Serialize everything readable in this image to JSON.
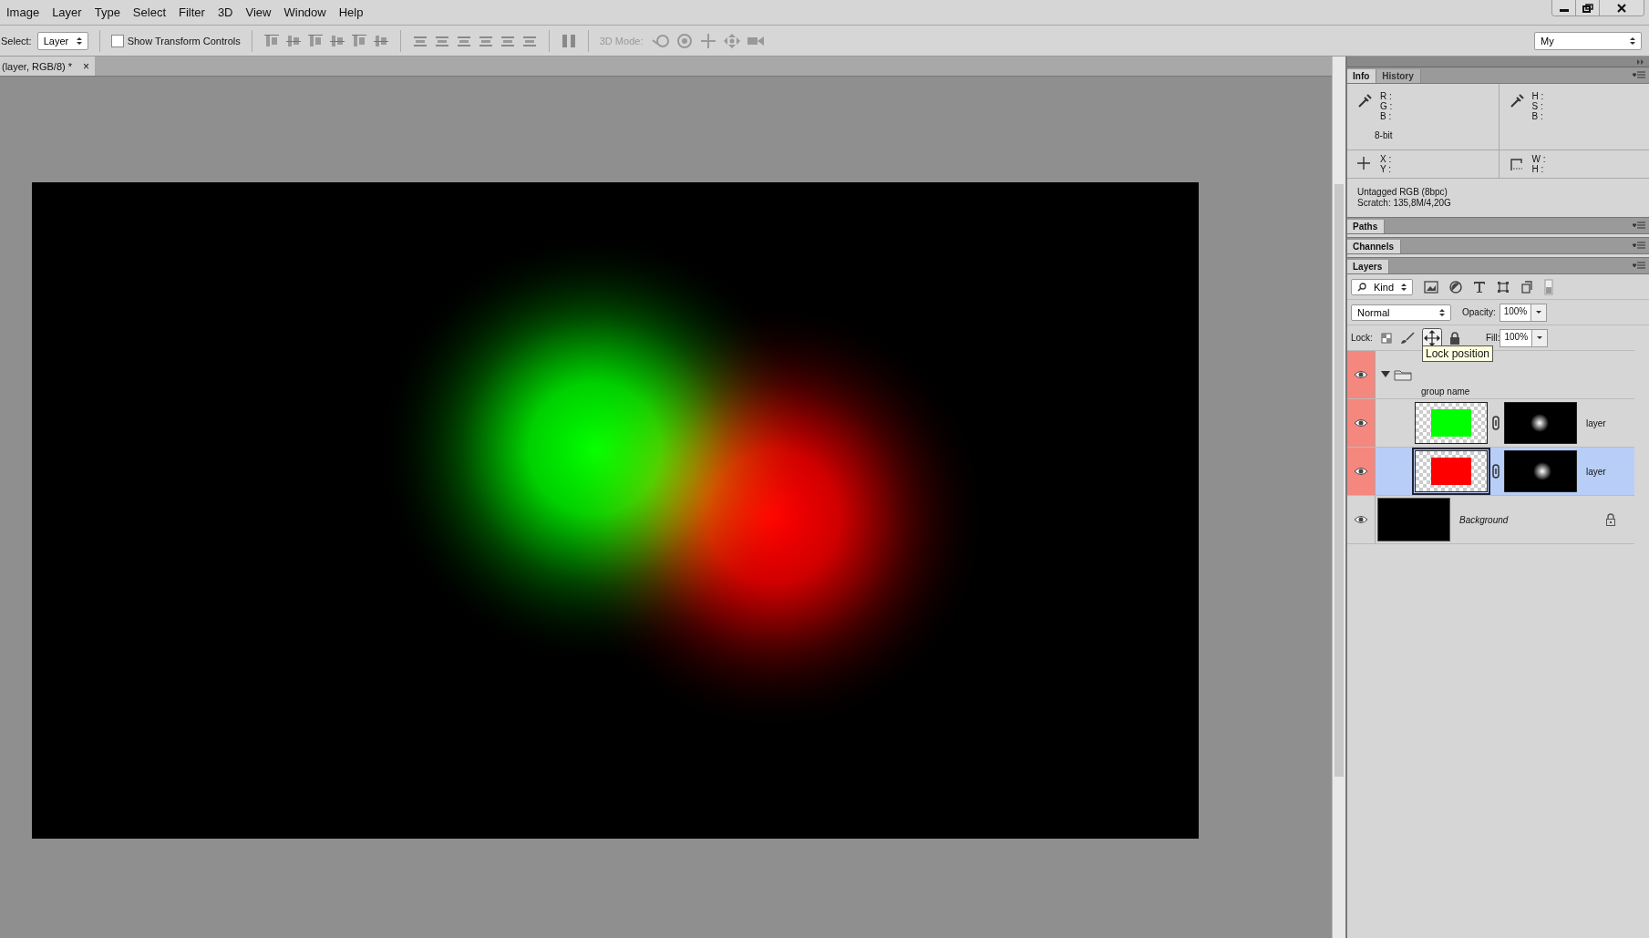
{
  "menu": [
    {
      "label": "Image"
    },
    {
      "label": "Layer"
    },
    {
      "label": "Type"
    },
    {
      "label": "Select"
    },
    {
      "label": "Filter"
    },
    {
      "label": "3D"
    },
    {
      "label": "View"
    },
    {
      "label": "Window"
    },
    {
      "label": "Help"
    }
  ],
  "toolbar": {
    "select_label": "Select:",
    "select_value": "Layer",
    "transform": {
      "label": "Show Transform Controls",
      "checked": false
    },
    "mode_label": "3D Mode:",
    "workspace": "My"
  },
  "document_tab": {
    "title": "(layer, RGB/8) *",
    "close": "×"
  },
  "info_panel": {
    "tabs": [
      {
        "label": "Info",
        "selected": true
      },
      {
        "label": "History",
        "selected": false
      }
    ],
    "rgb": [
      "R :",
      "G :",
      "B :"
    ],
    "hsb": [
      "H :",
      "S :",
      "B :"
    ],
    "bit_depth": "8-bit",
    "xy": [
      "X :",
      "Y :"
    ],
    "wh": [
      "W :",
      "H :"
    ],
    "profile": "Untagged RGB (8bpc)",
    "scratch": "Scratch: 135,8M/4,20G"
  },
  "collapsed_panels": [
    {
      "label": "Paths"
    },
    {
      "label": "Channels"
    }
  ],
  "layers_panel": {
    "tab": "Layers",
    "filter": "Kind",
    "blend_mode": "Normal",
    "opacity_label": "Opacity:",
    "opacity": "100%",
    "lock_label": "Lock:",
    "fill_label": "Fill:",
    "fill": "100%",
    "tooltip": "Lock position",
    "layers": [
      {
        "kind": "group",
        "name": "group name",
        "visible": true,
        "expanded": true,
        "color": "#f4877e",
        "selected": false,
        "children": [
          {
            "kind": "layer",
            "name": "layer",
            "visible": true,
            "color": "#00ff00",
            "selected": false
          },
          {
            "kind": "layer",
            "name": "layer",
            "visible": true,
            "color": "#ff0000",
            "selected": true
          }
        ]
      },
      {
        "kind": "background",
        "name": "Background",
        "visible": true,
        "locked": true,
        "selected": false
      }
    ]
  }
}
